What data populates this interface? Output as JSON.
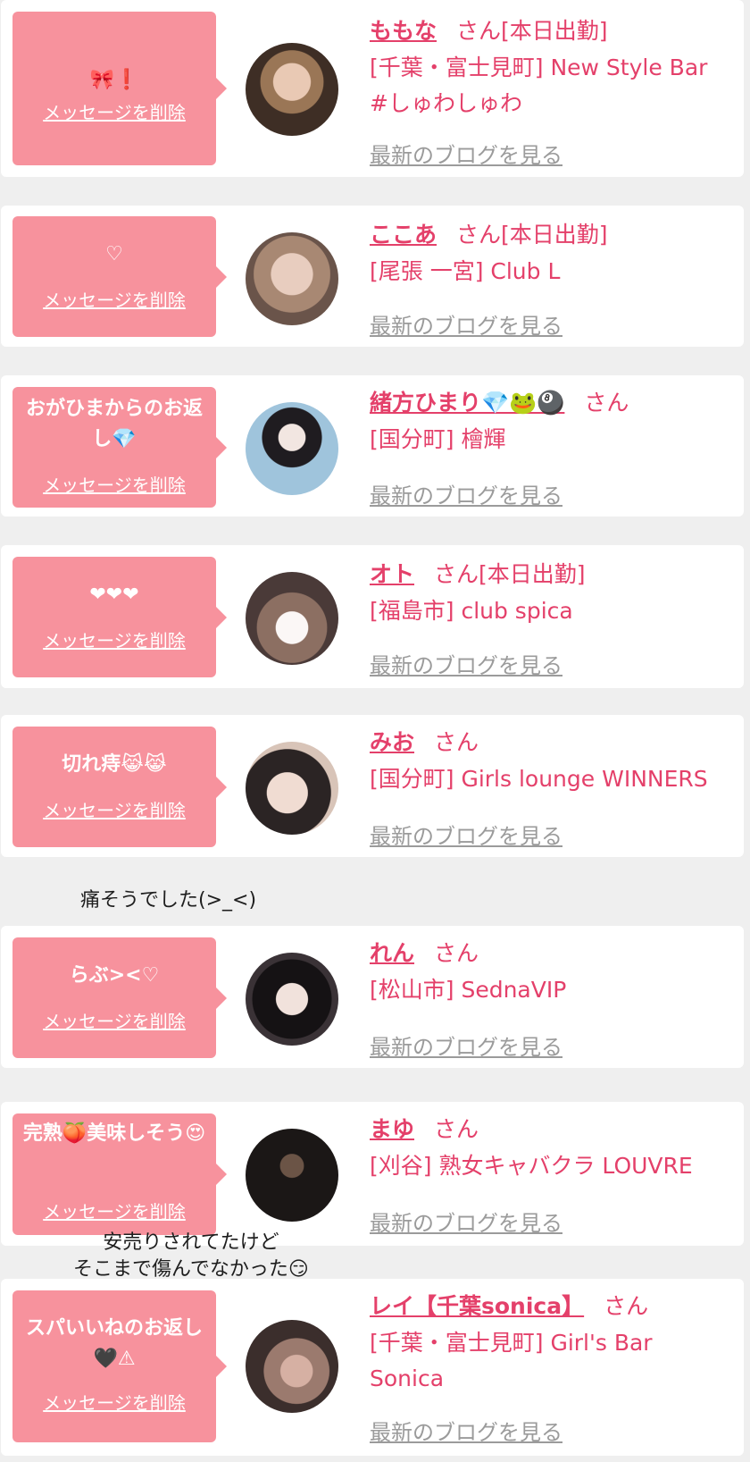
{
  "common": {
    "delete_label": "メッセージを削除",
    "blog_label": "最新のブログを見る",
    "san": "さん"
  },
  "items": [
    {
      "message": "🎀❗",
      "name": "ももな",
      "status": "[本日出勤]",
      "shop": "[千葉・富士見町] New Style Bar #しゅわしゅわ"
    },
    {
      "message": "♡",
      "name": "ここあ",
      "status": "[本日出勤]",
      "shop": "[尾張 一宮] Club L"
    },
    {
      "message": "おがひまからのお返し💎",
      "name": "緒方ひまり💎🐸🎱",
      "status": "",
      "shop": "[国分町] 檜輝"
    },
    {
      "message": "❤❤❤",
      "name": "オト",
      "status": "[本日出勤]",
      "shop": "[福島市] club spica"
    },
    {
      "message": "切れ痔😹😹",
      "name": "みお",
      "status": "",
      "shop": "[国分町] Girls lounge WINNERS"
    },
    {
      "message": "らぶ><♡",
      "name": "れん",
      "status": "",
      "shop": "[松山市] SednaVIP"
    },
    {
      "message": "完熟🍑美味しそう😍",
      "name": "まゆ",
      "status": "",
      "shop": "[刈谷] 熟女キャバクラ LOUVRE"
    },
    {
      "message": "スパいいねのお返し🖤⚠",
      "name": "レイ【千葉sonica】",
      "status": "",
      "shop": "[千葉・富士見町] Girl's Bar Sonica"
    }
  ],
  "notes": {
    "note1": "痛そうでした(>_<)",
    "note2_line1": "安売りされてたけど",
    "note2_line2": "そこまで傷んでなかった😏"
  },
  "colors": {
    "bubble": "#f7929d",
    "accent": "#e4406a",
    "link_gray": "#9b9b9b",
    "background": "#efefef"
  }
}
